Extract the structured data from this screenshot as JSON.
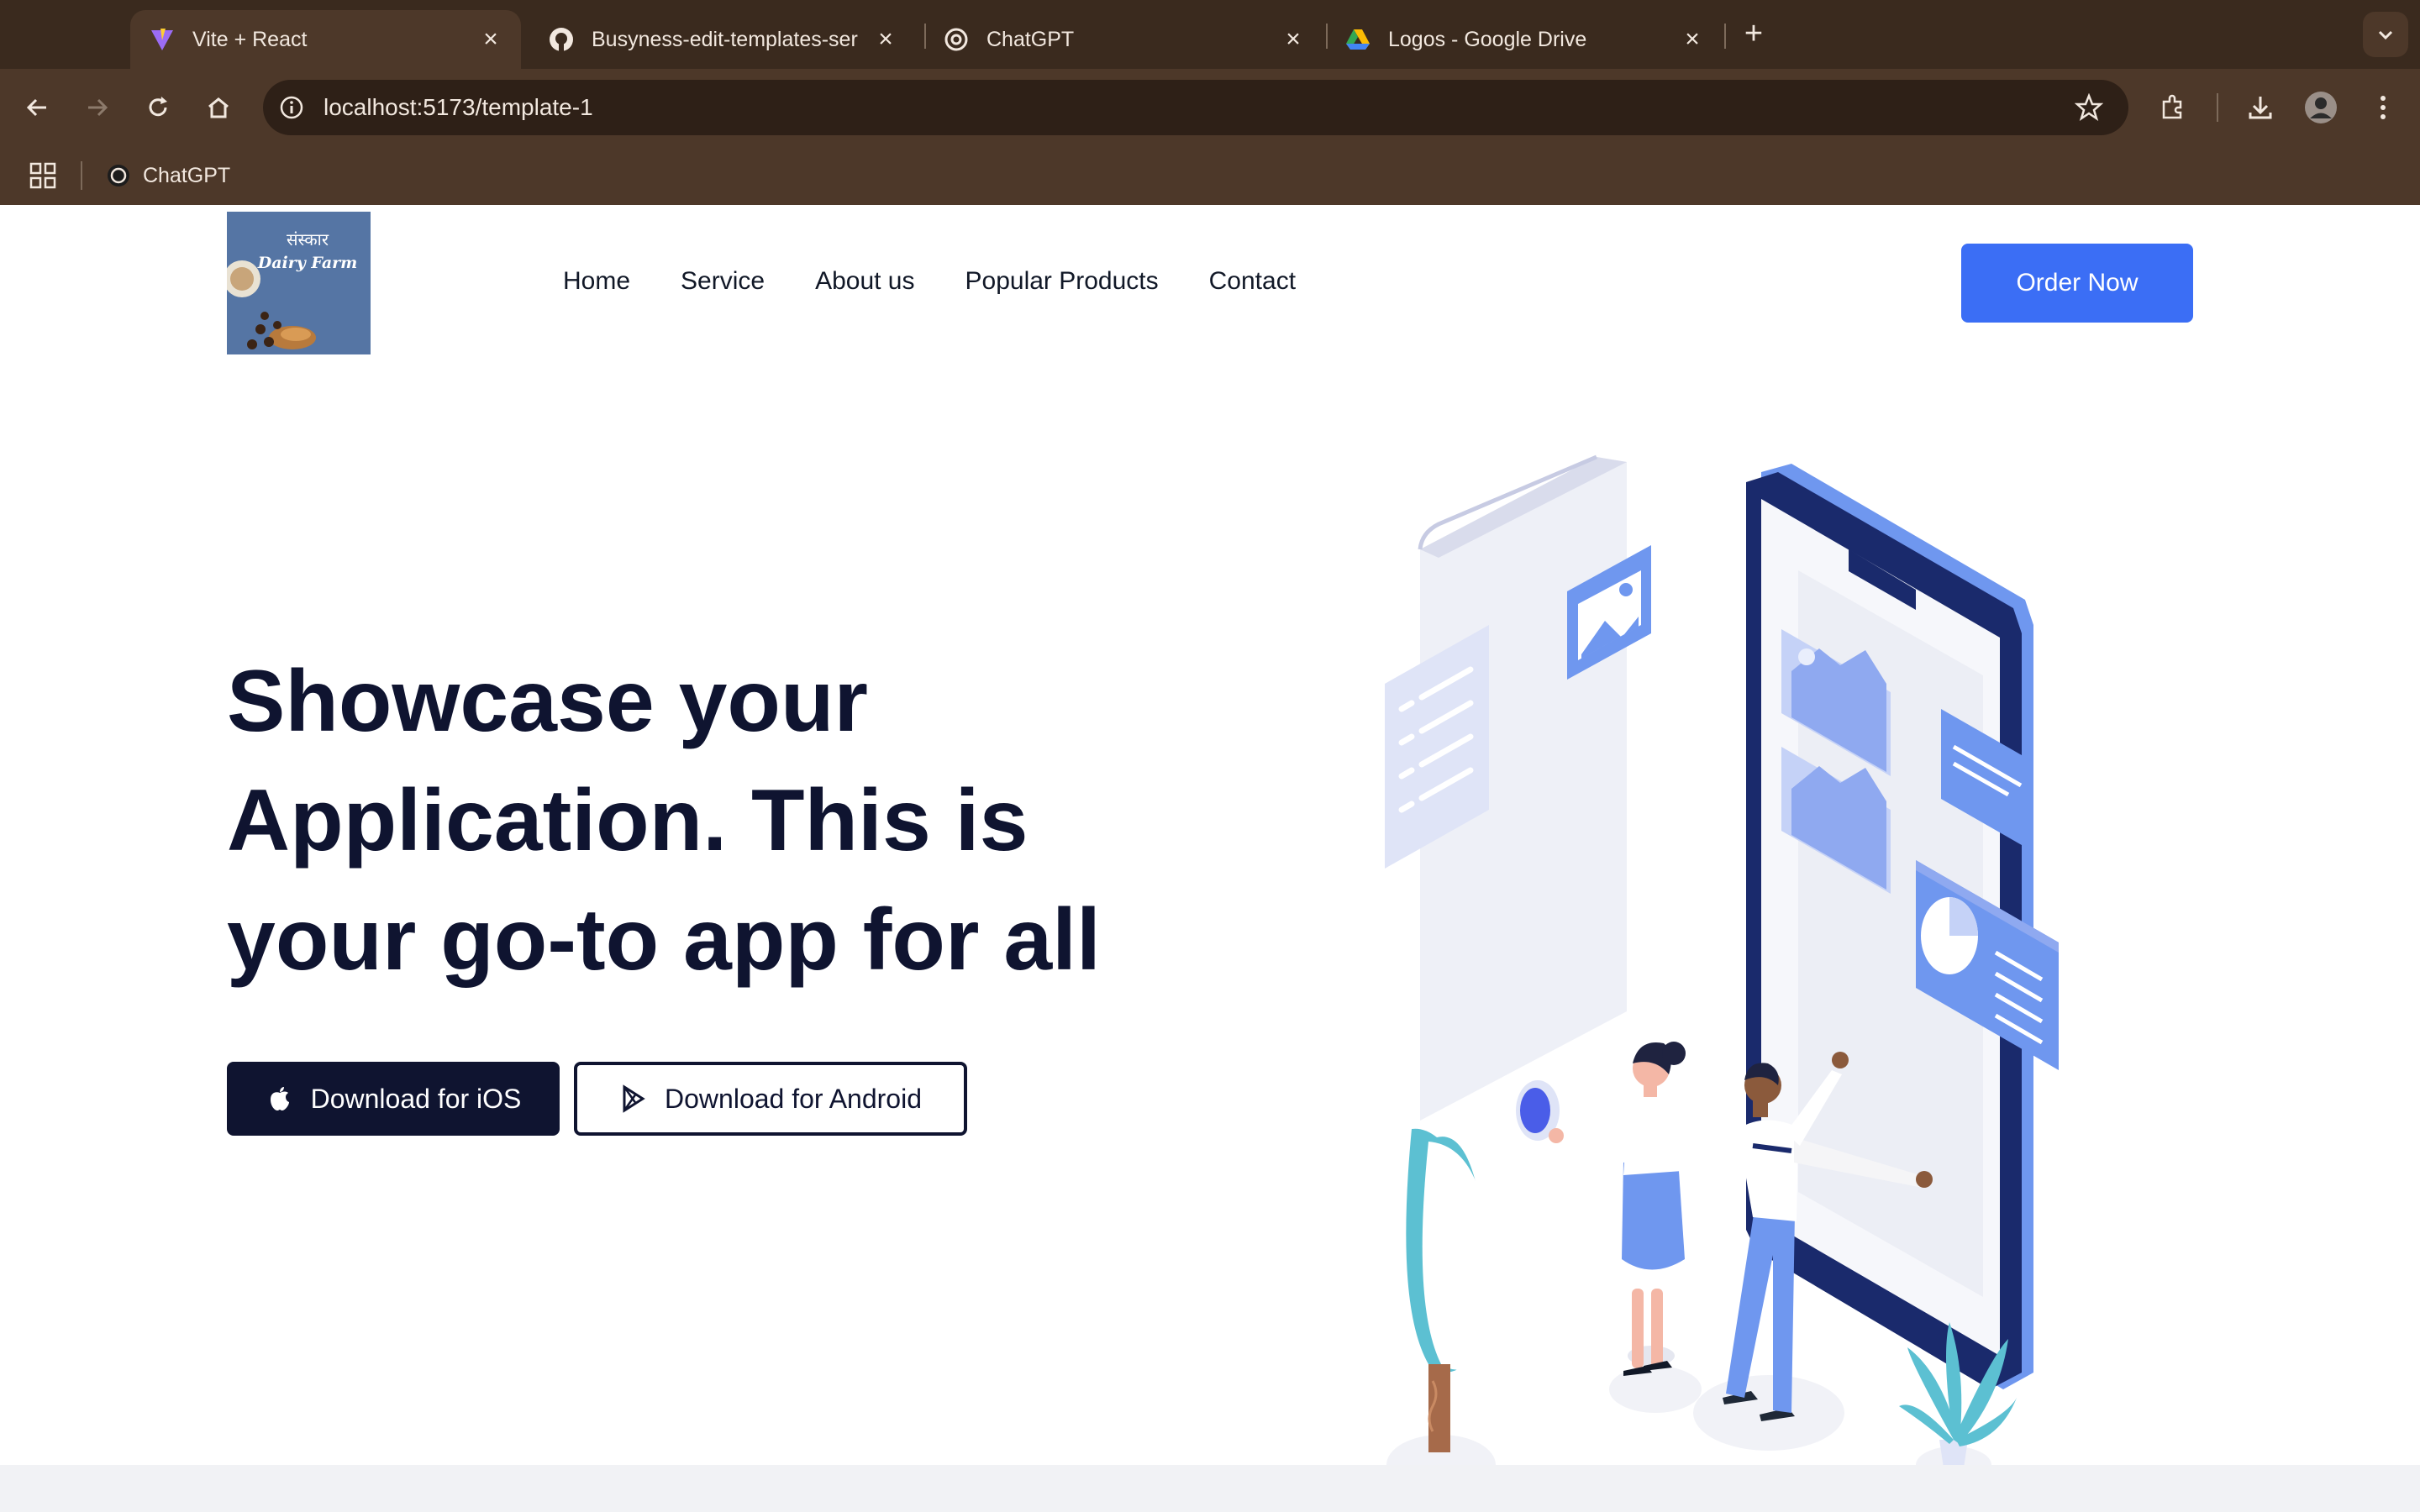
{
  "browser": {
    "tabs": [
      {
        "title": "Vite + React",
        "icon": "vite-icon",
        "active": true
      },
      {
        "title": "Busyness-edit-templates-ser",
        "icon": "github-icon",
        "active": false
      },
      {
        "title": "ChatGPT",
        "icon": "chatgpt-icon",
        "active": false
      },
      {
        "title": "Logos - Google Drive",
        "icon": "google-drive-icon",
        "active": false
      }
    ],
    "url": "localhost:5173/template-1",
    "bookmarks": [
      {
        "label": "ChatGPT",
        "icon": "chatgpt-icon"
      }
    ],
    "colors": {
      "frame": "#3a2a1e",
      "toolbar": "#4d3829",
      "omnibox": "#2e2017"
    }
  },
  "site": {
    "logo": {
      "line1": "संस्कार",
      "line2": "Dairy Farm"
    },
    "nav": [
      "Home",
      "Service",
      "About us",
      "Popular Products",
      "Contact"
    ],
    "order_button": "Order Now",
    "hero": {
      "title": "Showcase your Application. This is your go-to app for all",
      "ios_button": "Download for iOS",
      "android_button": "Download for Android"
    },
    "colors": {
      "primary": "#3b6ef5",
      "dark": "#0f1430",
      "illustration_blue": "#6f97ef",
      "illustration_navy": "#1a2a6c"
    }
  }
}
